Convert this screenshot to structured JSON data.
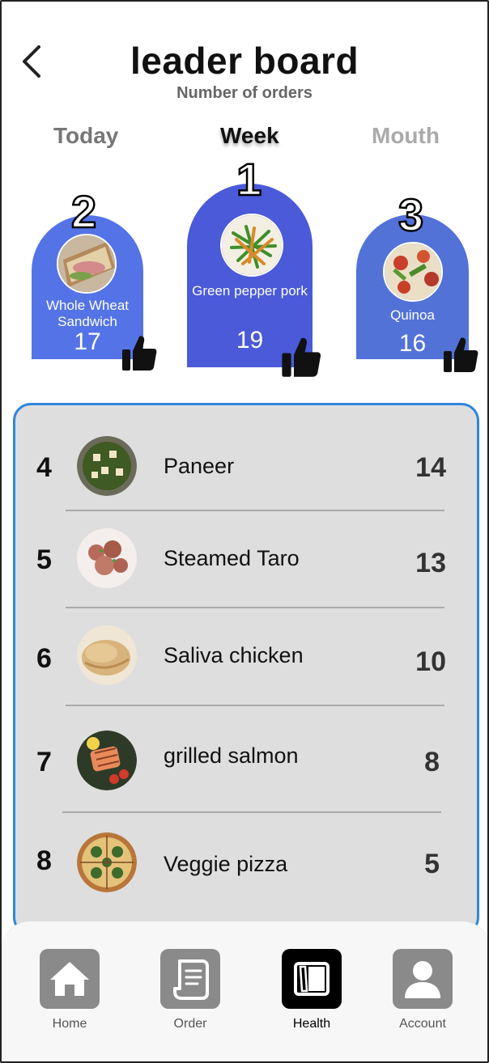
{
  "header": {
    "title": "leader board",
    "subtitle": "Number of orders"
  },
  "tabs": [
    {
      "label": "Today",
      "active": false
    },
    {
      "label": "Week",
      "active": true
    },
    {
      "label": "Mouth",
      "active": false
    }
  ],
  "podium": [
    {
      "rank": "1",
      "name": "Green pepper pork",
      "count": "19"
    },
    {
      "rank": "2",
      "name": "Whole Wheat Sandwich",
      "count": "17"
    },
    {
      "rank": "3",
      "name": "Quinoa",
      "count": "16"
    }
  ],
  "list": [
    {
      "rank": "4",
      "name": "Paneer",
      "count": "14"
    },
    {
      "rank": "5",
      "name": "Steamed Taro",
      "count": "13"
    },
    {
      "rank": "6",
      "name": "Saliva chicken",
      "count": "10"
    },
    {
      "rank": "7",
      "name": "grilled salmon",
      "count": "8"
    },
    {
      "rank": "8",
      "name": "Veggie pizza",
      "count": "5"
    }
  ],
  "nav": [
    {
      "label": "Home",
      "icon": "home-icon"
    },
    {
      "label": "Order",
      "icon": "scroll-icon"
    },
    {
      "label": "Health",
      "icon": "book-icon",
      "active": true
    },
    {
      "label": "Account",
      "icon": "user-icon"
    }
  ],
  "colors": {
    "accent_blue": "#4a5ad8",
    "list_border": "#2e86d9",
    "list_bg": "#dedede"
  }
}
